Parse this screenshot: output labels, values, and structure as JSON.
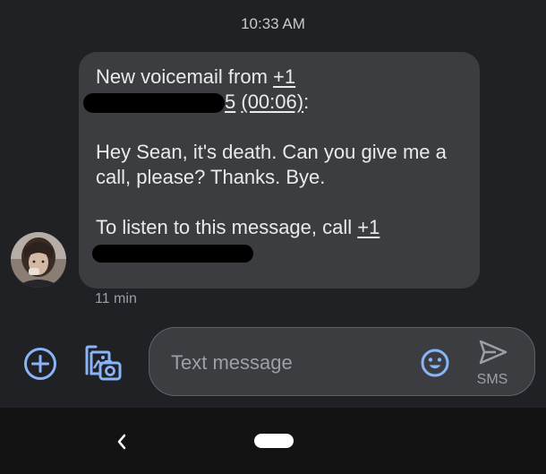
{
  "conversation": {
    "timestamp": "10:33 AM"
  },
  "message": {
    "line1_prefix": "New voicemail from ",
    "caller_number_visible": "+1",
    "line2_tail": "5",
    "duration": "(00:06)",
    "line2_suffix": ":",
    "transcript": "Hey Sean, it's death. Can you give me a call, please? Thanks. Bye.",
    "listen_prefix": "To listen to this message, call ",
    "listen_number_visible": "+1",
    "relative_time": "11 min"
  },
  "composer": {
    "placeholder": "Text message",
    "send_label": "SMS"
  },
  "icons": {
    "add": "add-circle-icon",
    "gallery": "add-photo-icon",
    "emoji": "emoji-icon",
    "send": "send-icon",
    "back": "back-icon",
    "home": "home-pill"
  },
  "colors": {
    "background": "#202124",
    "bubble": "#3c3d41",
    "accent": "#8ab4f8",
    "text": "#e8eaed",
    "secondary_text": "#9aa0a6",
    "nav_bar": "#131314"
  }
}
